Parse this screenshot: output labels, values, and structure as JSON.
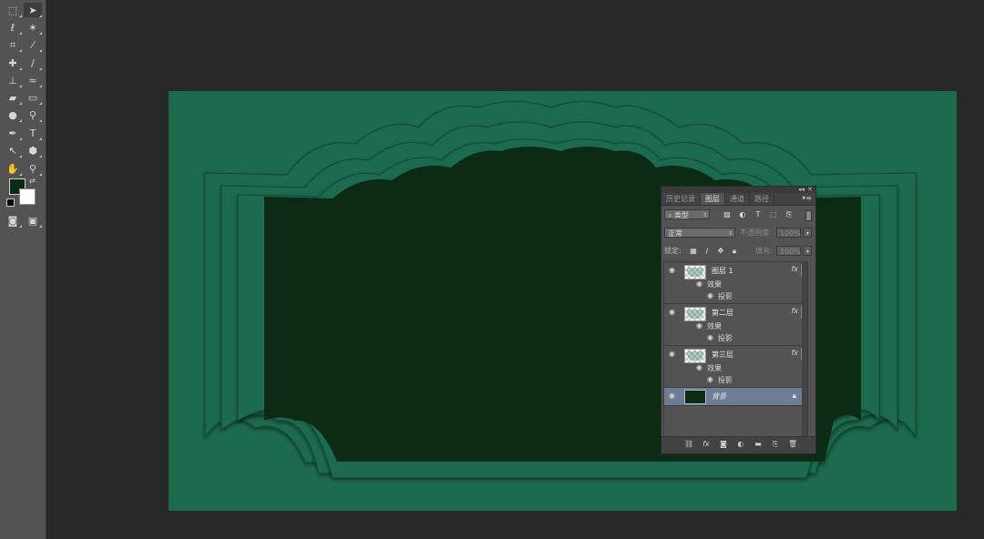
{
  "toolbar": {
    "tools": [
      {
        "name": "marquee-tool-icon",
        "glyph": "⬚",
        "row": 0,
        "col": 0
      },
      {
        "name": "move-tool-icon",
        "glyph": "➤",
        "row": 0,
        "col": 1,
        "active": true
      },
      {
        "name": "lasso-tool-icon",
        "glyph": "ℓ",
        "row": 1,
        "col": 0
      },
      {
        "name": "magic-wand-tool-icon",
        "glyph": "✶",
        "row": 1,
        "col": 1
      },
      {
        "name": "crop-tool-icon",
        "glyph": "⌗",
        "row": 2,
        "col": 0
      },
      {
        "name": "eyedropper-tool-icon",
        "glyph": "⁄",
        "row": 2,
        "col": 1
      },
      {
        "name": "healing-brush-tool-icon",
        "glyph": "✚",
        "row": 3,
        "col": 0
      },
      {
        "name": "brush-tool-icon",
        "glyph": "∕",
        "row": 3,
        "col": 1
      },
      {
        "name": "clone-stamp-tool-icon",
        "glyph": "⊥",
        "row": 4,
        "col": 0
      },
      {
        "name": "history-brush-tool-icon",
        "glyph": "≈",
        "row": 4,
        "col": 1
      },
      {
        "name": "eraser-tool-icon",
        "glyph": "▰",
        "row": 5,
        "col": 0
      },
      {
        "name": "gradient-tool-icon",
        "glyph": "▭",
        "row": 5,
        "col": 1
      },
      {
        "name": "blur-tool-icon",
        "glyph": "●",
        "row": 6,
        "col": 0
      },
      {
        "name": "dodge-tool-icon",
        "glyph": "⚲",
        "row": 6,
        "col": 1
      },
      {
        "name": "pen-tool-icon",
        "glyph": "✒",
        "row": 7,
        "col": 0
      },
      {
        "name": "type-tool-icon",
        "glyph": "T",
        "row": 7,
        "col": 1
      },
      {
        "name": "path-selection-tool-icon",
        "glyph": "↖",
        "row": 8,
        "col": 0
      },
      {
        "name": "shape-tool-icon",
        "glyph": "⬢",
        "row": 8,
        "col": 1
      },
      {
        "name": "hand-tool-icon",
        "glyph": "✋",
        "row": 9,
        "col": 0
      },
      {
        "name": "zoom-tool-icon",
        "glyph": "⚲",
        "row": 9,
        "col": 1
      },
      {
        "name": "quick-mask-icon",
        "glyph": "◙",
        "row": 12,
        "col": 0
      },
      {
        "name": "screen-mode-icon",
        "glyph": "▣",
        "row": 12,
        "col": 1
      }
    ],
    "foreground_color": "#0c2b15",
    "background_color": "#ffffff"
  },
  "canvas": {
    "frame_color": "#1c6b4f",
    "stage_color": "#0c2b15"
  },
  "layers_panel": {
    "tabs": [
      "历史记录",
      "图层",
      "通道",
      "路径"
    ],
    "active_tab": "图层",
    "filter_kind": "类型",
    "blend_mode": "正常",
    "opacity_label": "不透明度:",
    "opacity_value": "100%",
    "lock_label": "锁定:",
    "fill_label": "填充:",
    "fill_value": "100%",
    "layers": [
      {
        "name": "图层 1",
        "effects_label": "效果",
        "effect": "投影",
        "fx": "fx"
      },
      {
        "name": "第二层",
        "effects_label": "效果",
        "effect": "投影",
        "fx": "fx"
      },
      {
        "name": "第三层",
        "effects_label": "效果",
        "effect": "投影",
        "fx": "fx"
      }
    ],
    "background_layer": {
      "name": "背景"
    }
  }
}
